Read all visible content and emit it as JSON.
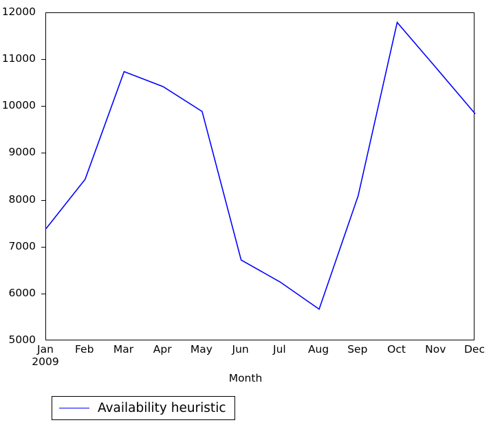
{
  "chart_data": {
    "type": "line",
    "title": "",
    "xlabel": "Month",
    "ylabel": "",
    "categories": [
      "Jan",
      "Feb",
      "Mar",
      "Apr",
      "May",
      "Jun",
      "Jul",
      "Aug",
      "Sep",
      "Oct",
      "Nov",
      "Dec"
    ],
    "x_sublabels": {
      "Jan": "2009"
    },
    "series": [
      {
        "name": "Availability heuristic",
        "color": "#0000ff",
        "values": [
          7400,
          8450,
          10750,
          10430,
          9900,
          6730,
          6260,
          5680,
          8100,
          11800,
          10830,
          9850
        ]
      }
    ],
    "ylim": [
      5000,
      12000
    ],
    "yticks": [
      5000,
      6000,
      7000,
      8000,
      9000,
      10000,
      11000,
      12000
    ],
    "ytick_labels": [
      "5000",
      "6000",
      "7000",
      "8000",
      "9000",
      "10000",
      "11000",
      "12000"
    ],
    "xlim_index": [
      0,
      11
    ],
    "grid": false,
    "legend_position": "below-left",
    "legend_entries": [
      "Availability heuristic"
    ]
  },
  "axes": {
    "x_axis_label": "Month",
    "year_label": "2009"
  },
  "legend": {
    "entry_label": "Availability heuristic"
  }
}
